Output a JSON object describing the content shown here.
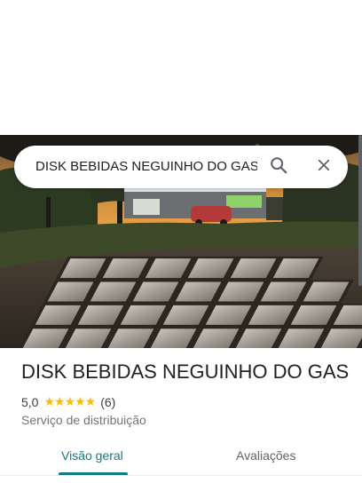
{
  "search": {
    "query": "DISK BEBIDAS NEGUINHO DO GAS",
    "search_icon": "search-icon",
    "close_icon": "close-icon"
  },
  "place": {
    "name": "DISK BEBIDAS NEGUINHO DO GAS",
    "rating": "5,0",
    "stars": "★★★★★",
    "review_count": "(6)",
    "category": "Serviço de distribuição",
    "photo": "place-photo"
  },
  "tabs": [
    {
      "label": "Visão geral",
      "selected": true
    },
    {
      "label": "Avaliações",
      "selected": false
    }
  ],
  "colors": {
    "accent": "#137a87",
    "star": "#fbbc04"
  }
}
